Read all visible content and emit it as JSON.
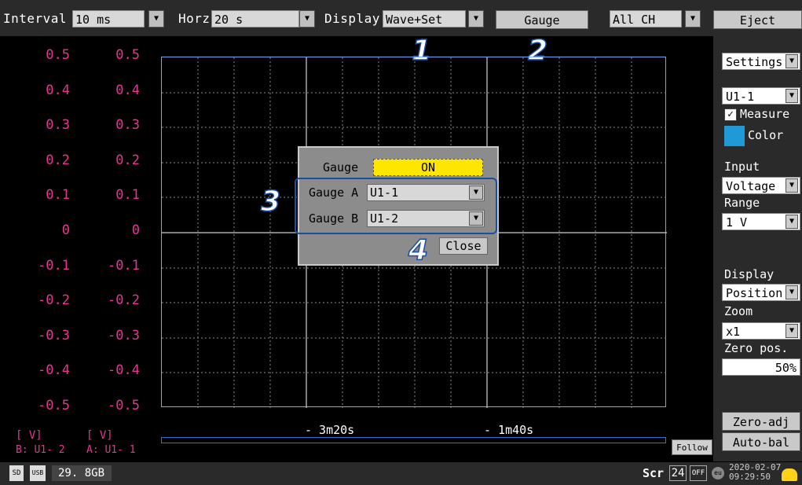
{
  "toolbar": {
    "interval_label": "Interval",
    "interval_value": "10 ms",
    "horz_label": "Horz",
    "horz_value": "20 s",
    "display_label": "Display",
    "display_value": "Wave+Set",
    "gauge_button": "Gauge",
    "channel_value": "All CH",
    "eject_button": "Eject"
  },
  "markers": [
    "1",
    "2",
    "3",
    "4"
  ],
  "axis": {
    "left_ticks": [
      "0.5",
      "0.4",
      "0.3",
      "0.2",
      "0.1",
      "0",
      "-0.1",
      "-0.2",
      "-0.3",
      "-0.4",
      "-0.5"
    ],
    "right_ticks": [
      "0.5",
      "0.4",
      "0.3",
      "0.2",
      "0.1",
      "0",
      "-0.1",
      "-0.2",
      "-0.3",
      "-0.4",
      "-0.5"
    ],
    "unit_left": "[     V]",
    "unit_right": "[     V]",
    "b_label": "B:  U1- 2",
    "a_label": "A:  U1- 1"
  },
  "time": {
    "t1": "- 3m20s",
    "t2": "- 1m40s"
  },
  "follow_button": "Follow",
  "sidebar": {
    "settings": "Settings",
    "channel": "U1-1",
    "measure": "Measure",
    "color": "Color",
    "color_value": "#1f9ad6",
    "input_label": "Input",
    "input_value": "Voltage",
    "range_label": "Range",
    "range_value": "1 V",
    "display_label": "Display",
    "display_value": "Position",
    "zoom_label": "Zoom",
    "zoom_value": "x1",
    "zero_label": "Zero pos.",
    "zero_value": "50%",
    "zero_adj": "Zero-adj",
    "auto_bal": "Auto-bal"
  },
  "dialog": {
    "gauge_label": "Gauge",
    "gauge_value": "ON",
    "gauge_a_label": "Gauge A",
    "gauge_a_value": "U1-1",
    "gauge_b_label": "Gauge B",
    "gauge_b_value": "U1-2",
    "close": "Close"
  },
  "status": {
    "storage": "29. 8GB",
    "date": "2020-02-07",
    "time": "09:29:50",
    "scr": "Scr",
    "num": "24",
    "off": "OFF"
  }
}
